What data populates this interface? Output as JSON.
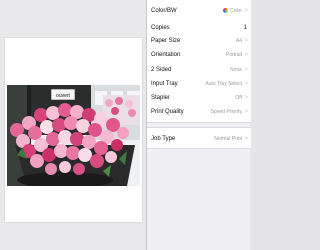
{
  "settings": [
    {
      "id": "color-bw",
      "label": "Color/BW",
      "value": "Color",
      "icon": "color-wheel-icon",
      "chevron": true
    },
    {
      "id": "copies",
      "label": "Copies",
      "value": "1",
      "chevron": false
    },
    {
      "id": "paper-size",
      "label": "Paper Size",
      "value": "A4",
      "chevron": true
    },
    {
      "id": "orientation",
      "label": "Orientation",
      "value": "Portrait",
      "chevron": true
    },
    {
      "id": "two-sided",
      "label": "2 Sided",
      "value": "None",
      "chevron": true
    },
    {
      "id": "input-tray",
      "label": "Input Tray",
      "value": "Auto Tray Select",
      "chevron": true
    },
    {
      "id": "stapler",
      "label": "Stapler",
      "value": "Off",
      "chevron": true
    },
    {
      "id": "print-quality",
      "label": "Print Quality",
      "value": "Speed Priority",
      "chevron": true
    },
    {
      "id": "job-type",
      "label": "Job Type",
      "value": "Normal Print",
      "chevron": true
    }
  ],
  "chevron_glyph": ">",
  "preview": {
    "photo": "pink-roses-bouquet",
    "sign_text": "ouvert"
  }
}
